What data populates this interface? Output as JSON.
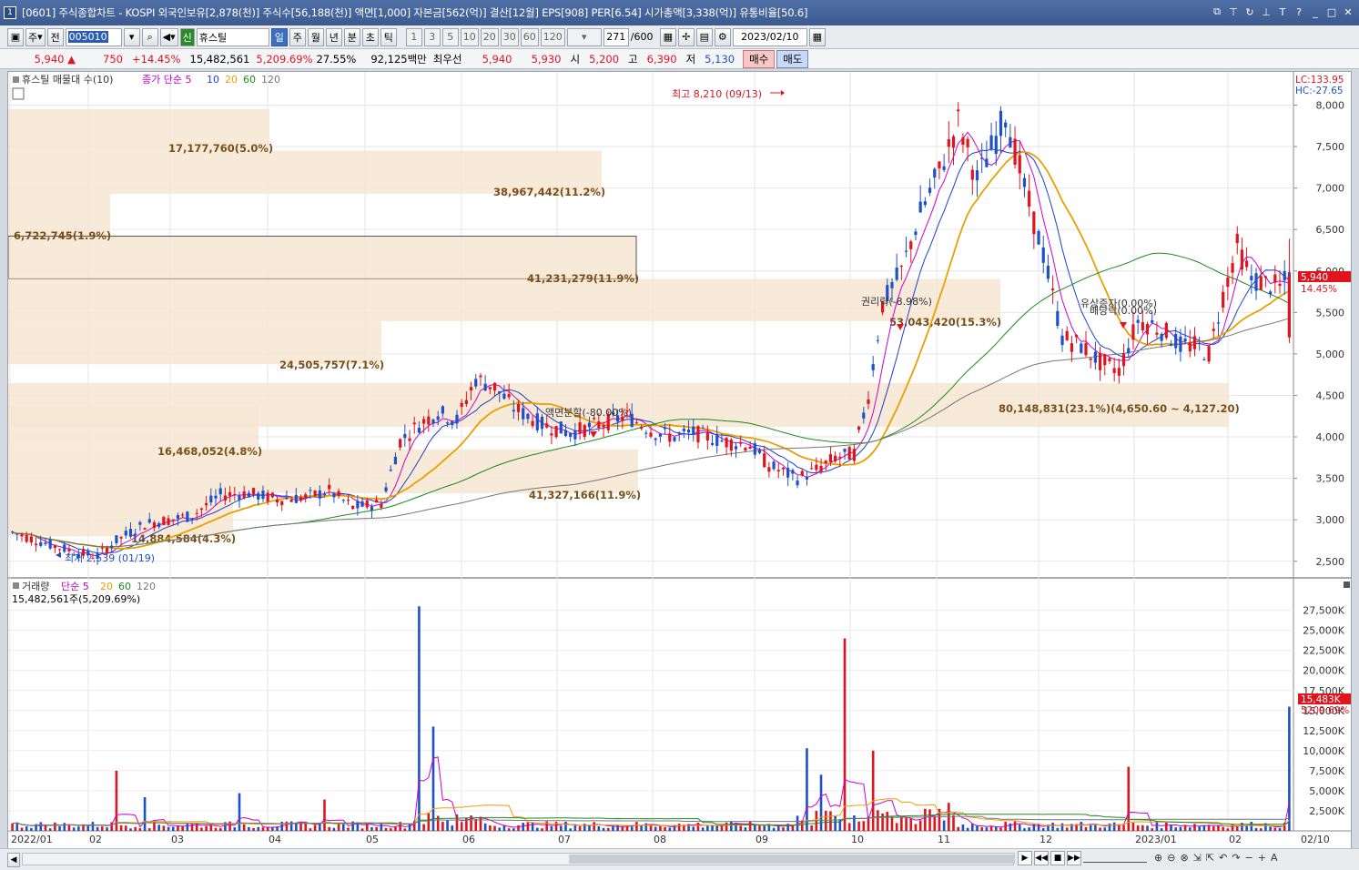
{
  "window": {
    "app_number": "1",
    "title": "[0601] 주식종합차트 - KOSPI 외국인보유[2,878(천)] 주식수[56,188(천)] 액면[1,000] 자본금[562(억)] 결산[12월] EPS[908] PER[6.54] 시가총액[3,338(억)] 유통비율[50.6]"
  },
  "toolbar": {
    "period_select": "주",
    "prev_label": "전",
    "stock_code": "005010",
    "stock_name": "휴스틸",
    "stock_prefix": "신",
    "periods": [
      "일",
      "주",
      "월",
      "년",
      "분",
      "초",
      "틱"
    ],
    "period_selected": "일",
    "intervals": [
      "1",
      "3",
      "5",
      "10",
      "20",
      "30",
      "60",
      "120"
    ],
    "count": "271",
    "count_max": "/600",
    "date": "2023/02/10"
  },
  "quote": {
    "price": "5,940",
    "change": "750",
    "change_pct": "+14.45%",
    "volume": "15,482,561",
    "volume_ratio": "5,209.69%",
    "turnover": "27.55%",
    "amount": "92,125백만",
    "best_bid_label": "최우선",
    "best_ask": "5,940",
    "best_bid": "5,930",
    "open_label": "시",
    "open": "5,200",
    "high_label": "고",
    "high": "6,390",
    "low_label": "저",
    "low": "5,130",
    "buy_label": "매수",
    "sell_label": "매도"
  },
  "price_panel": {
    "legend_title": "휴스틸 매물대 수(10)",
    "legend_ma": "종가 단순 5",
    "ma_periods": [
      "10",
      "20",
      "60",
      "120"
    ],
    "ma_colors": [
      "#cc00cc",
      "#1e3fc8",
      "#e8a000",
      "#1a8a1a",
      "#777777"
    ],
    "lc_label": "LC:133.95",
    "hc_label": "HC:-27.65",
    "current_price_tag": "5,940",
    "current_pct_tag": "14.45%",
    "y_ticks": [
      "8,000",
      "7,500",
      "7,000",
      "6,500",
      "6,000",
      "5,500",
      "5,000",
      "4,500",
      "4,000",
      "3,500",
      "3,000",
      "2,500"
    ],
    "volume_profile": [
      "17,177,760(5.0%)",
      "38,967,442(11.2%)",
      "6,722,745(1.9%)",
      "41,231,279(11.9%)",
      "53,043,420(15.3%)",
      "24,505,757(7.1%)",
      "80,148,831(23.1%)(4,650.60 ~ 4,127.20)",
      "16,468,052(4.8%)",
      "41,327,166(11.9%)",
      "14,884,584(4.3%)"
    ],
    "annotations": {
      "high": "최고 8,210 (09/13)",
      "low": "최저 2,539 (01/19)",
      "split": "액면분할(-80.00%)",
      "rights": "권리락(-8.98%)",
      "capital_increase": "유상증자(0.00%)",
      "dividend": "배당락(0.00%)"
    }
  },
  "volume_panel": {
    "legend_title": "거래량",
    "legend_ma": "단순 5",
    "ma_periods": [
      "20",
      "60",
      "120"
    ],
    "volume_text": "15,482,561주(5,209.69%)",
    "current_tag": "15,483K",
    "current_pct_tag": "5209.69%",
    "y_ticks": [
      "27,500K",
      "25,000K",
      "22,500K",
      "20,000K",
      "17,500K",
      "15,000K",
      "12,500K",
      "10,000K",
      "7,500K",
      "5,000K",
      "2,500K"
    ]
  },
  "x_axis": {
    "labels": [
      "2022/01",
      "02",
      "03",
      "04",
      "05",
      "06",
      "07",
      "08",
      "09",
      "10",
      "11",
      "12",
      "2023/01",
      "02"
    ],
    "end_label": "02/10"
  },
  "chart_data": {
    "type": "candlestick",
    "title": "휴스틸 매물대 수(10)",
    "price_range": [
      2300,
      8400
    ],
    "highest": 8210,
    "lowest": 2539,
    "last_close": 5940,
    "volume_profile_levels": [
      {
        "volume": 17177760,
        "pct": 5.0
      },
      {
        "volume": 38967442,
        "pct": 11.2
      },
      {
        "volume": 6722745,
        "pct": 1.9
      },
      {
        "volume": 41231279,
        "pct": 11.9
      },
      {
        "volume": 53043420,
        "pct": 15.3
      },
      {
        "volume": 24505757,
        "pct": 7.1
      },
      {
        "volume": 80148831,
        "pct": 23.1
      },
      {
        "volume": 16468052,
        "pct": 4.8
      },
      {
        "volume": 41327166,
        "pct": 11.9
      },
      {
        "volume": 14884584,
        "pct": 4.3
      }
    ]
  }
}
